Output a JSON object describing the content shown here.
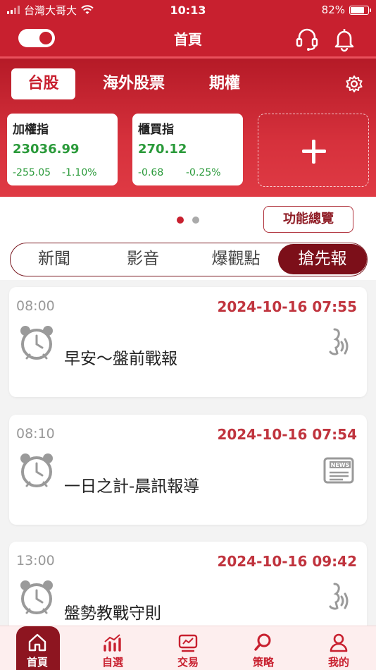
{
  "status_bar": {
    "carrier": "台灣大哥大",
    "time": "10:13",
    "battery": "82%",
    "battery_level": 0.82
  },
  "header": {
    "title": "首頁"
  },
  "market_tabs": [
    {
      "label": "台股"
    },
    {
      "label": "海外股票"
    },
    {
      "label": "期權"
    }
  ],
  "indices": [
    {
      "name": "加權指",
      "value": "23036.99",
      "change": "-255.05",
      "percent": "-1.10%"
    },
    {
      "name": "櫃買指",
      "value": "270.12",
      "change": "-0.68",
      "percent": "-0.25%"
    }
  ],
  "overview_button": "功能總覽",
  "segments": [
    {
      "label": "新聞"
    },
    {
      "label": "影音"
    },
    {
      "label": "爆觀點"
    },
    {
      "label": "搶先報"
    }
  ],
  "news": [
    {
      "time": "08:00",
      "date": "2024-10-16 07:55",
      "title": "早安～盤前戰報",
      "icon": "audio-icon"
    },
    {
      "time": "08:10",
      "date": "2024-10-16 07:54",
      "title": "一日之計-晨訊報導",
      "icon": "newspaper-icon",
      "badge": "NEWS"
    },
    {
      "time": "13:00",
      "date": "2024-10-16 09:42",
      "title": "盤勢教戰守則",
      "icon": "audio-icon"
    }
  ],
  "bottom_nav": [
    {
      "label": "首頁"
    },
    {
      "label": "自選"
    },
    {
      "label": "交易"
    },
    {
      "label": "策略"
    },
    {
      "label": "我的"
    }
  ],
  "colors": {
    "brand": "#c8202f",
    "dark_brand": "#7c0f19",
    "down": "#2a9a3a",
    "date": "#c0343e"
  }
}
